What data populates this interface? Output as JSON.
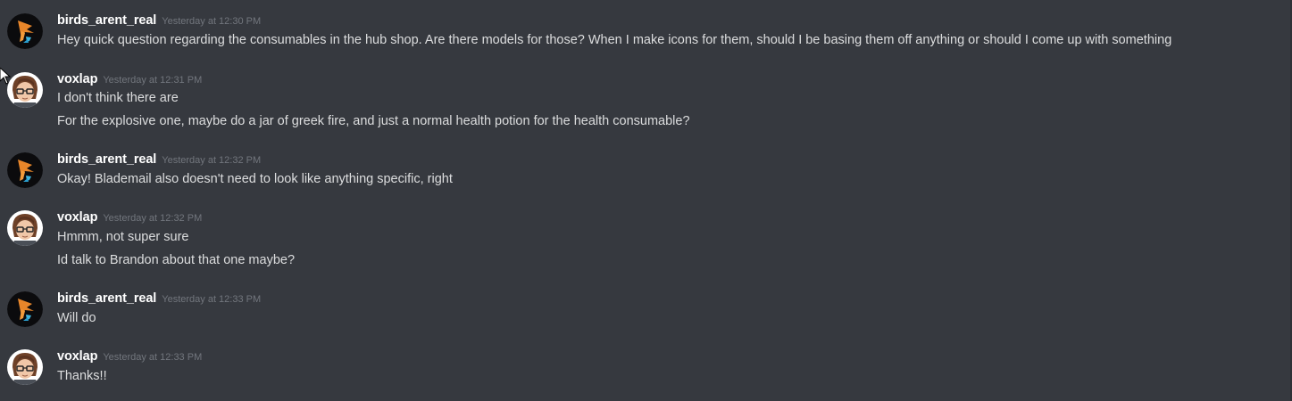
{
  "messages": [
    {
      "username": "birds_arent_real",
      "timestamp": "Yesterday at 12:30 PM",
      "avatar": "orange-bird-avatar",
      "lines": [
        "Hey quick question regarding the consumables in the hub shop. Are there models for those? When I make icons for them, should I be basing them off anything or should I come up with something"
      ]
    },
    {
      "username": "voxlap",
      "timestamp": "Yesterday at 12:31 PM",
      "avatar": "glasses-person-avatar",
      "lines": [
        "I don't think there are",
        "For the explosive one, maybe do a jar of greek fire, and just a normal health potion for the health consumable?"
      ]
    },
    {
      "username": "birds_arent_real",
      "timestamp": "Yesterday at 12:32 PM",
      "avatar": "orange-bird-avatar",
      "lines": [
        "Okay! Blademail also doesn't need to look like anything specific, right"
      ]
    },
    {
      "username": "voxlap",
      "timestamp": "Yesterday at 12:32 PM",
      "avatar": "glasses-person-avatar",
      "lines": [
        "Hmmm, not super sure",
        "Id talk to Brandon about that one maybe?"
      ]
    },
    {
      "username": "birds_arent_real",
      "timestamp": "Yesterday at 12:33 PM",
      "avatar": "orange-bird-avatar",
      "lines": [
        "Will do"
      ]
    },
    {
      "username": "voxlap",
      "timestamp": "Yesterday at 12:33 PM",
      "avatar": "glasses-person-avatar",
      "lines": [
        "Thanks!!"
      ]
    }
  ],
  "colors": {
    "background": "#36393f",
    "username": "#ffffff",
    "timestamp": "#72767d",
    "message_text": "#dcddde"
  }
}
